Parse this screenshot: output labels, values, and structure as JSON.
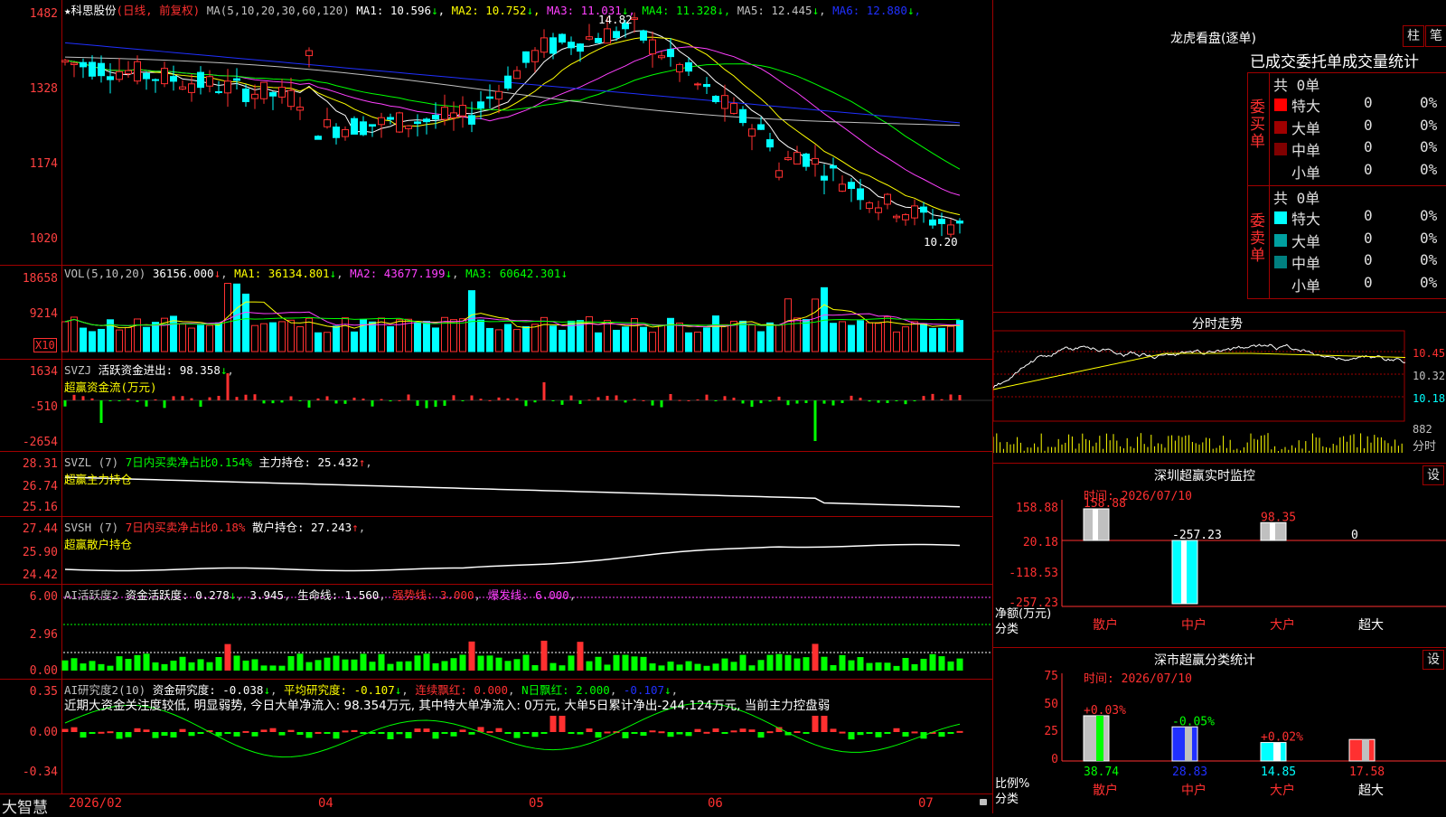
{
  "price_header": {
    "star": "★",
    "stock": "科思股份",
    "period": "(日线, 前复权)",
    "ma_params": "MA(5,10,20,30,60,120)",
    "ma": [
      {
        "label": "MA1: 10.596",
        "arrow": "↓",
        "color": "#ffffff"
      },
      {
        "label": "MA2: 10.752",
        "arrow": "↓",
        "color": "#ffff00"
      },
      {
        "label": "MA3: 11.031",
        "arrow": "↓",
        "color": "#ff40ff"
      },
      {
        "label": "MA4: 11.328",
        "arrow": "↓",
        "color": "#00ff00"
      },
      {
        "label": "MA5: 12.445",
        "arrow": "↓",
        "color": "#c0c0c0"
      },
      {
        "label": "MA6: 12.880",
        "arrow": "↓",
        "color": "#2030ff"
      }
    ],
    "ylabels": [
      "1482",
      "1328",
      "1174",
      "1020"
    ],
    "hi_label": "14.82",
    "lo_label": "10.20"
  },
  "vol_header": {
    "title": "VOL(5,10,20)",
    "val": "36156.000",
    "ma1": "MA1: 36134.801",
    "ma2": "MA2: 43677.199",
    "ma3": "MA3: 60642.301",
    "ylabels": [
      "18658",
      "9214"
    ],
    "unit": "X10"
  },
  "svzj": {
    "title": "SVZJ",
    "line1": "活跃资金进出: 98.358",
    "line2": "超赢资金流(万元)",
    "ylabels": [
      "1634",
      "-510",
      "-2654"
    ]
  },
  "svzl": {
    "title": "SVZL (7)",
    "desc": "7日内买卖净占比0.154%",
    "val": "主力持仓: 25.432",
    "line2": "超赢主力持仓",
    "ylabels": [
      "28.31",
      "26.74",
      "25.16"
    ]
  },
  "svsh": {
    "title": "SVSH (7)",
    "desc": "7日内买卖净占比0.18%",
    "val": "散户持仓: 27.243",
    "line2": "超赢散户持仓",
    "ylabels": [
      "27.44",
      "25.90",
      "24.42"
    ]
  },
  "ai2": {
    "title": "AI活跃度2",
    "v1": "资金活跃度: 0.278",
    "v2": "3.945",
    "v3": "生命线: 1.560",
    "v4": "强势线: 3.000",
    "v5": "爆发线: 6.000",
    "ylabels": [
      "6.00",
      "2.96",
      "0.00"
    ]
  },
  "air": {
    "title": "AI研究度2(10)",
    "v1": "资金研究度: -0.038",
    "v2": "平均研究度: -0.107",
    "v3": "连续飘红: 0.000",
    "v4": "N日飘红: 2.000",
    "v5": "-0.107",
    "note": "近期大资金关注度较低, 明显弱势, 今日大单净流入: 98.354万元, 其中特大单净流入: 0万元, 大单5日累计净出-244.124万元, 当前主力控盘弱",
    "ylabels": [
      "0.35",
      "0.00",
      "-0.34"
    ]
  },
  "xaxis": {
    "labels": [
      "2026/02",
      "04",
      "05",
      "06",
      "07"
    ],
    "brand": "大智慧"
  },
  "lhb": {
    "title": "龙虎看盘(逐单)",
    "btn1": "柱",
    "btn2": "笔",
    "subtitle": "已成交委托单成交量统计",
    "buy_label": "委买单",
    "sell_label": "委卖单",
    "buy_total": "共 0单",
    "sell_total": "共 0单",
    "buy_rows": [
      {
        "name": "特大",
        "n": "0",
        "p": "0%",
        "color": "#ff0000"
      },
      {
        "name": "大单",
        "n": "0",
        "p": "0%",
        "color": "#a00000"
      },
      {
        "name": "中单",
        "n": "0",
        "p": "0%",
        "color": "#800000"
      },
      {
        "name": "小单",
        "n": "0",
        "p": "0%",
        "color": ""
      }
    ],
    "sell_rows": [
      {
        "name": "特大",
        "n": "0",
        "p": "0%",
        "color": "#00ffff"
      },
      {
        "name": "大单",
        "n": "0",
        "p": "0%",
        "color": "#00a0a0"
      },
      {
        "name": "中单",
        "n": "0",
        "p": "0%",
        "color": "#008080"
      },
      {
        "name": "小单",
        "n": "0",
        "p": "0%",
        "color": ""
      }
    ]
  },
  "fenshi": {
    "title": "分时走势",
    "ylabels": [
      "10.45",
      "10.32",
      "10.18"
    ],
    "vol_label": "882",
    "sub": "分时"
  },
  "monitor": {
    "title": "深圳超赢实时监控",
    "set": "设",
    "time": "时间: 2026/07/10",
    "ylabels": [
      "158.88",
      "20.18",
      "-118.53",
      "-257.23"
    ],
    "ylabel_title": "净额(万元)",
    "cat_title": "分类",
    "cats": [
      "散户",
      "中户",
      "大户",
      "超大"
    ],
    "values": [
      "158.88",
      "-257.23",
      "98.35",
      "0"
    ]
  },
  "stats": {
    "title": "深市超赢分类统计",
    "set": "设",
    "time": "时间: 2026/07/10",
    "ylabels": [
      "75",
      "50",
      "25",
      "0"
    ],
    "ylabel_title": "比例%",
    "cat_title": "分类",
    "cats": [
      "散户",
      "中户",
      "大户",
      "超大"
    ],
    "bar_values": [
      "38.74",
      "28.83",
      "14.85",
      "17.58"
    ],
    "changes": [
      "+0.03%",
      "-0.05%",
      "+0.02%",
      ""
    ]
  }
}
